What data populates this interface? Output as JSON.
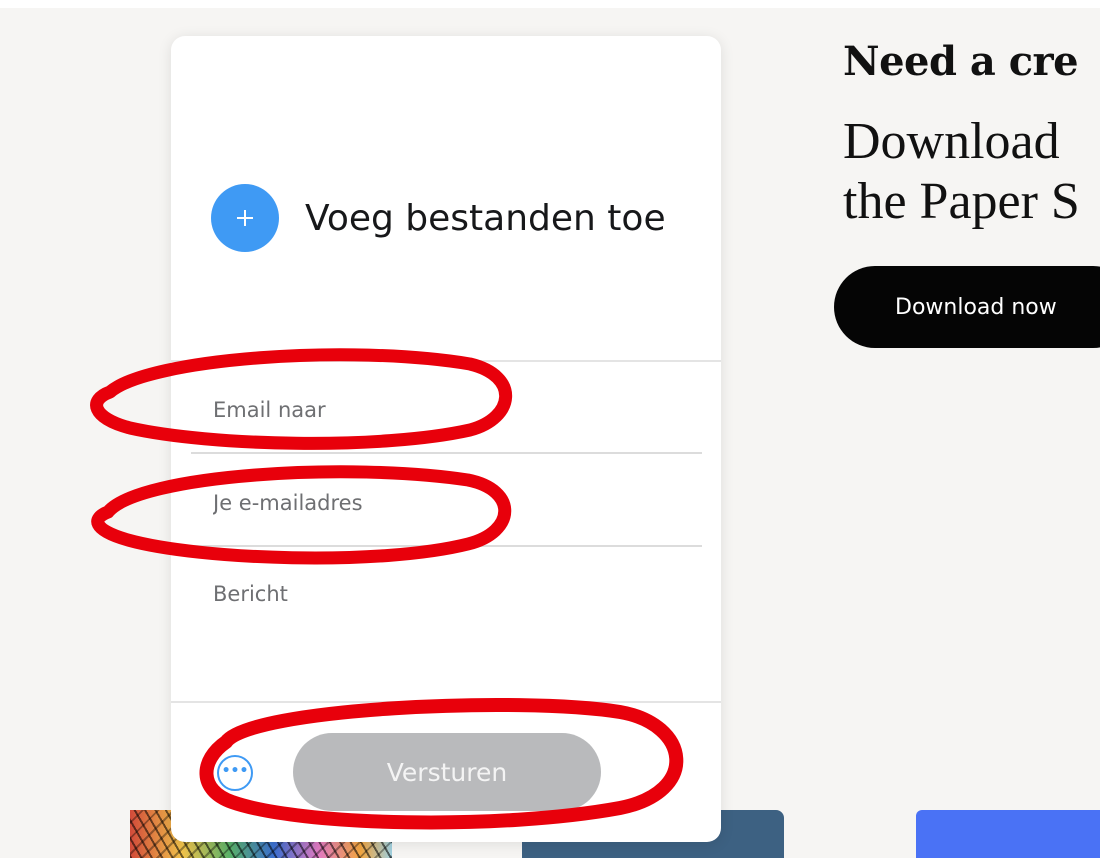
{
  "promo": {
    "title": "Need a cre",
    "subtitle": "Download\nthe Paper S",
    "download_label": "Download now"
  },
  "upload_card": {
    "add_files_label": "Voeg bestanden toe",
    "add_icon": "plus-icon",
    "email_to_placeholder": "Email naar",
    "your_email_placeholder": "Je e-mailadres",
    "message_placeholder": "Bericht",
    "more_options_icon": "more-dots-icon",
    "more_options_glyph": "•••",
    "send_label": "Versturen"
  },
  "colors": {
    "accent": "#3f9af4",
    "send_disabled": "#b9babc",
    "annotation": "#e8000b",
    "download_button": "#050505"
  }
}
